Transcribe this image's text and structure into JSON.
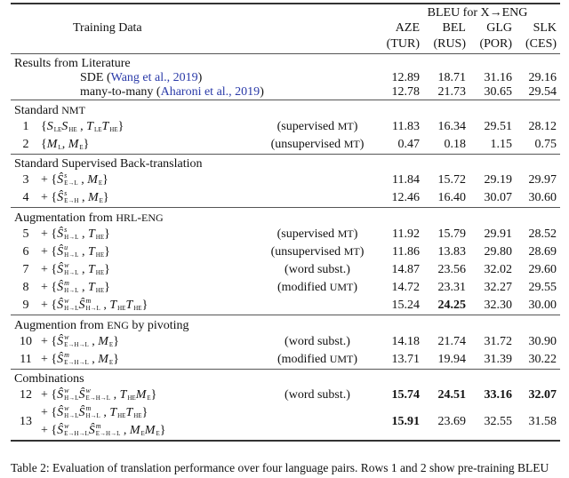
{
  "header": {
    "training_data": "Training Data",
    "bleu_title": "BLEU for X→ENG",
    "columns": [
      {
        "lang": "AZE",
        "pivot": "(TUR)"
      },
      {
        "lang": "BEL",
        "pivot": "(RUS)"
      },
      {
        "lang": "GLG",
        "pivot": "(POR)"
      },
      {
        "lang": "SLK",
        "pivot": "(CES)"
      }
    ]
  },
  "sections": [
    {
      "title": "Results from Literature",
      "literature": true,
      "rows": [
        {
          "label": "SDE (",
          "cite": "Wang et al., 2019",
          "close": ")",
          "values": [
            "12.89",
            "18.71",
            "31.16",
            "29.16"
          ],
          "bold": [
            false,
            false,
            false,
            false
          ]
        },
        {
          "label": "many-to-many (",
          "cite": "Aharoni et al., 2019",
          "close": ")",
          "values": [
            "12.78",
            "21.73",
            "30.65",
            "29.54"
          ],
          "bold": [
            false,
            false,
            false,
            false
          ]
        }
      ]
    },
    {
      "title": "Standard NMT",
      "rows": [
        {
          "num": "1",
          "formula": [
            [
              {
                "t": "{"
              },
              {
                "b": "S",
                "sub": "LE"
              },
              {
                "b": "S",
                "sub": "HE"
              },
              {
                "t": " , "
              },
              {
                "b": "T",
                "sub": "LE"
              },
              {
                "b": "T",
                "sub": "HE"
              },
              {
                "t": "}"
              }
            ]
          ],
          "note": "(supervised MT)",
          "values": [
            "11.83",
            "16.34",
            "29.51",
            "28.12"
          ],
          "bold": [
            false,
            false,
            false,
            false
          ]
        },
        {
          "num": "2",
          "formula": [
            [
              {
                "t": "{"
              },
              {
                "b": "M",
                "sub": "L"
              },
              {
                "t": ", "
              },
              {
                "b": "M",
                "sub": "E"
              },
              {
                "t": "}"
              }
            ]
          ],
          "note": "(unsupervised MT)",
          "values": [
            "0.47",
            "0.18",
            "1.15",
            "0.75"
          ],
          "bold": [
            false,
            false,
            false,
            false
          ]
        }
      ]
    },
    {
      "title": "Standard Supervised Back-translation",
      "rows": [
        {
          "num": "3",
          "formula": [
            [
              {
                "t": "+ {"
              },
              {
                "b": "Ŝ",
                "sup": "s",
                "sub": "E→L"
              },
              {
                "t": " , "
              },
              {
                "b": "M",
                "sub": "E"
              },
              {
                "t": "}"
              }
            ]
          ],
          "note": "",
          "values": [
            "11.84",
            "15.72",
            "29.19",
            "29.97"
          ],
          "bold": [
            false,
            false,
            false,
            false
          ]
        },
        {
          "num": "4",
          "formula": [
            [
              {
                "t": "+ {"
              },
              {
                "b": "Ŝ",
                "sup": "s",
                "sub": "E→H"
              },
              {
                "t": " , "
              },
              {
                "b": "M",
                "sub": "E"
              },
              {
                "t": "}"
              }
            ]
          ],
          "note": "",
          "values": [
            "12.46",
            "16.40",
            "30.07",
            "30.60"
          ],
          "bold": [
            false,
            false,
            false,
            false
          ]
        }
      ]
    },
    {
      "title": "Augmentation from HRL-ENG",
      "rows": [
        {
          "num": "5",
          "formula": [
            [
              {
                "t": "+ {"
              },
              {
                "b": "Ŝ",
                "sup": "s",
                "sub": "H→L"
              },
              {
                "t": " , "
              },
              {
                "b": "T",
                "sub": "HE"
              },
              {
                "t": "}"
              }
            ]
          ],
          "note": "(supervised MT)",
          "values": [
            "11.92",
            "15.79",
            "29.91",
            "28.52"
          ],
          "bold": [
            false,
            false,
            false,
            false
          ]
        },
        {
          "num": "6",
          "formula": [
            [
              {
                "t": "+ {"
              },
              {
                "b": "Ŝ",
                "sup": "u",
                "sub": "H→L"
              },
              {
                "t": " , "
              },
              {
                "b": "T",
                "sub": "HE"
              },
              {
                "t": "}"
              }
            ]
          ],
          "note": "(unsupervised MT)",
          "values": [
            "11.86",
            "13.83",
            "29.80",
            "28.69"
          ],
          "bold": [
            false,
            false,
            false,
            false
          ]
        },
        {
          "num": "7",
          "formula": [
            [
              {
                "t": "+ {"
              },
              {
                "b": "Ŝ",
                "sup": "w",
                "sub": "H→L"
              },
              {
                "t": " , "
              },
              {
                "b": "T",
                "sub": "HE"
              },
              {
                "t": "}"
              }
            ]
          ],
          "note": "(word subst.)",
          "values": [
            "14.87",
            "23.56",
            "32.02",
            "29.60"
          ],
          "bold": [
            false,
            false,
            false,
            false
          ]
        },
        {
          "num": "8",
          "formula": [
            [
              {
                "t": "+ {"
              },
              {
                "b": "Ŝ",
                "sup": "m",
                "sub": "H→L"
              },
              {
                "t": " , "
              },
              {
                "b": "T",
                "sub": "HE"
              },
              {
                "t": "}"
              }
            ]
          ],
          "note": "(modified UMT)",
          "values": [
            "14.72",
            "23.31",
            "32.27",
            "29.55"
          ],
          "bold": [
            false,
            false,
            false,
            false
          ]
        },
        {
          "num": "9",
          "formula": [
            [
              {
                "t": "+ {"
              },
              {
                "b": "Ŝ",
                "sup": "w",
                "sub": "H→L"
              },
              {
                "b": "Ŝ",
                "sup": "m",
                "sub": "H→L"
              },
              {
                "t": " , "
              },
              {
                "b": "T",
                "sub": "HE"
              },
              {
                "b": "T",
                "sub": "HE"
              },
              {
                "t": "}"
              }
            ]
          ],
          "note": "",
          "values": [
            "15.24",
            "24.25",
            "32.30",
            "30.00"
          ],
          "bold": [
            false,
            true,
            false,
            false
          ]
        }
      ]
    },
    {
      "title": "Augmention from ENG by pivoting",
      "rows": [
        {
          "num": "10",
          "formula": [
            [
              {
                "t": "+ {"
              },
              {
                "b": "Ŝ",
                "sup": "w",
                "sub": "E→H→L"
              },
              {
                "t": " , "
              },
              {
                "b": "M",
                "sub": "E"
              },
              {
                "t": "}"
              }
            ]
          ],
          "note": "(word subst.)",
          "values": [
            "14.18",
            "21.74",
            "31.72",
            "30.90"
          ],
          "bold": [
            false,
            false,
            false,
            false
          ]
        },
        {
          "num": "11",
          "formula": [
            [
              {
                "t": "+ {"
              },
              {
                "b": "Ŝ",
                "sup": "m",
                "sub": "E→H→L"
              },
              {
                "t": " , "
              },
              {
                "b": "M",
                "sub": "E"
              },
              {
                "t": "}"
              }
            ]
          ],
          "note": "(modified UMT)",
          "values": [
            "13.71",
            "19.94",
            "31.39",
            "30.22"
          ],
          "bold": [
            false,
            false,
            false,
            false
          ]
        }
      ]
    },
    {
      "title": "Combinations",
      "rows": [
        {
          "num": "12",
          "formula": [
            [
              {
                "t": "+ {"
              },
              {
                "b": "Ŝ",
                "sup": "w",
                "sub": "H→L"
              },
              {
                "b": "Ŝ",
                "sup": "w",
                "sub": "E→H→L"
              },
              {
                "t": " , "
              },
              {
                "b": "T",
                "sub": "HE"
              },
              {
                "b": "M",
                "sub": "E"
              },
              {
                "t": "}"
              }
            ]
          ],
          "note": "(word subst.)",
          "values": [
            "15.74",
            "24.51",
            "33.16",
            "32.07"
          ],
          "bold": [
            true,
            true,
            true,
            true
          ]
        },
        {
          "num": "13",
          "formula": [
            [
              {
                "t": "+ {"
              },
              {
                "b": "Ŝ",
                "sup": "w",
                "sub": "H→L"
              },
              {
                "b": "Ŝ",
                "sup": "m",
                "sub": "H→L"
              },
              {
                "t": " , "
              },
              {
                "b": "T",
                "sub": "HE"
              },
              {
                "b": "T",
                "sub": "HE"
              },
              {
                "t": "}"
              }
            ],
            [
              {
                "t": "+ {"
              },
              {
                "b": "Ŝ",
                "sup": "w",
                "sub": "E→H→L"
              },
              {
                "b": "Ŝ",
                "sup": "m",
                "sub": "E→H→L"
              },
              {
                "t": " , "
              },
              {
                "b": "M",
                "sub": "E"
              },
              {
                "b": "M",
                "sub": "E"
              },
              {
                "t": "}"
              }
            ]
          ],
          "note": "",
          "values": [
            "15.91",
            "23.69",
            "32.55",
            "31.58"
          ],
          "bold": [
            true,
            false,
            false,
            false
          ]
        }
      ]
    }
  ],
  "caption": "Table 2: Evaluation of translation performance over four language pairs. Rows 1 and 2 show pre-training BLEU"
}
